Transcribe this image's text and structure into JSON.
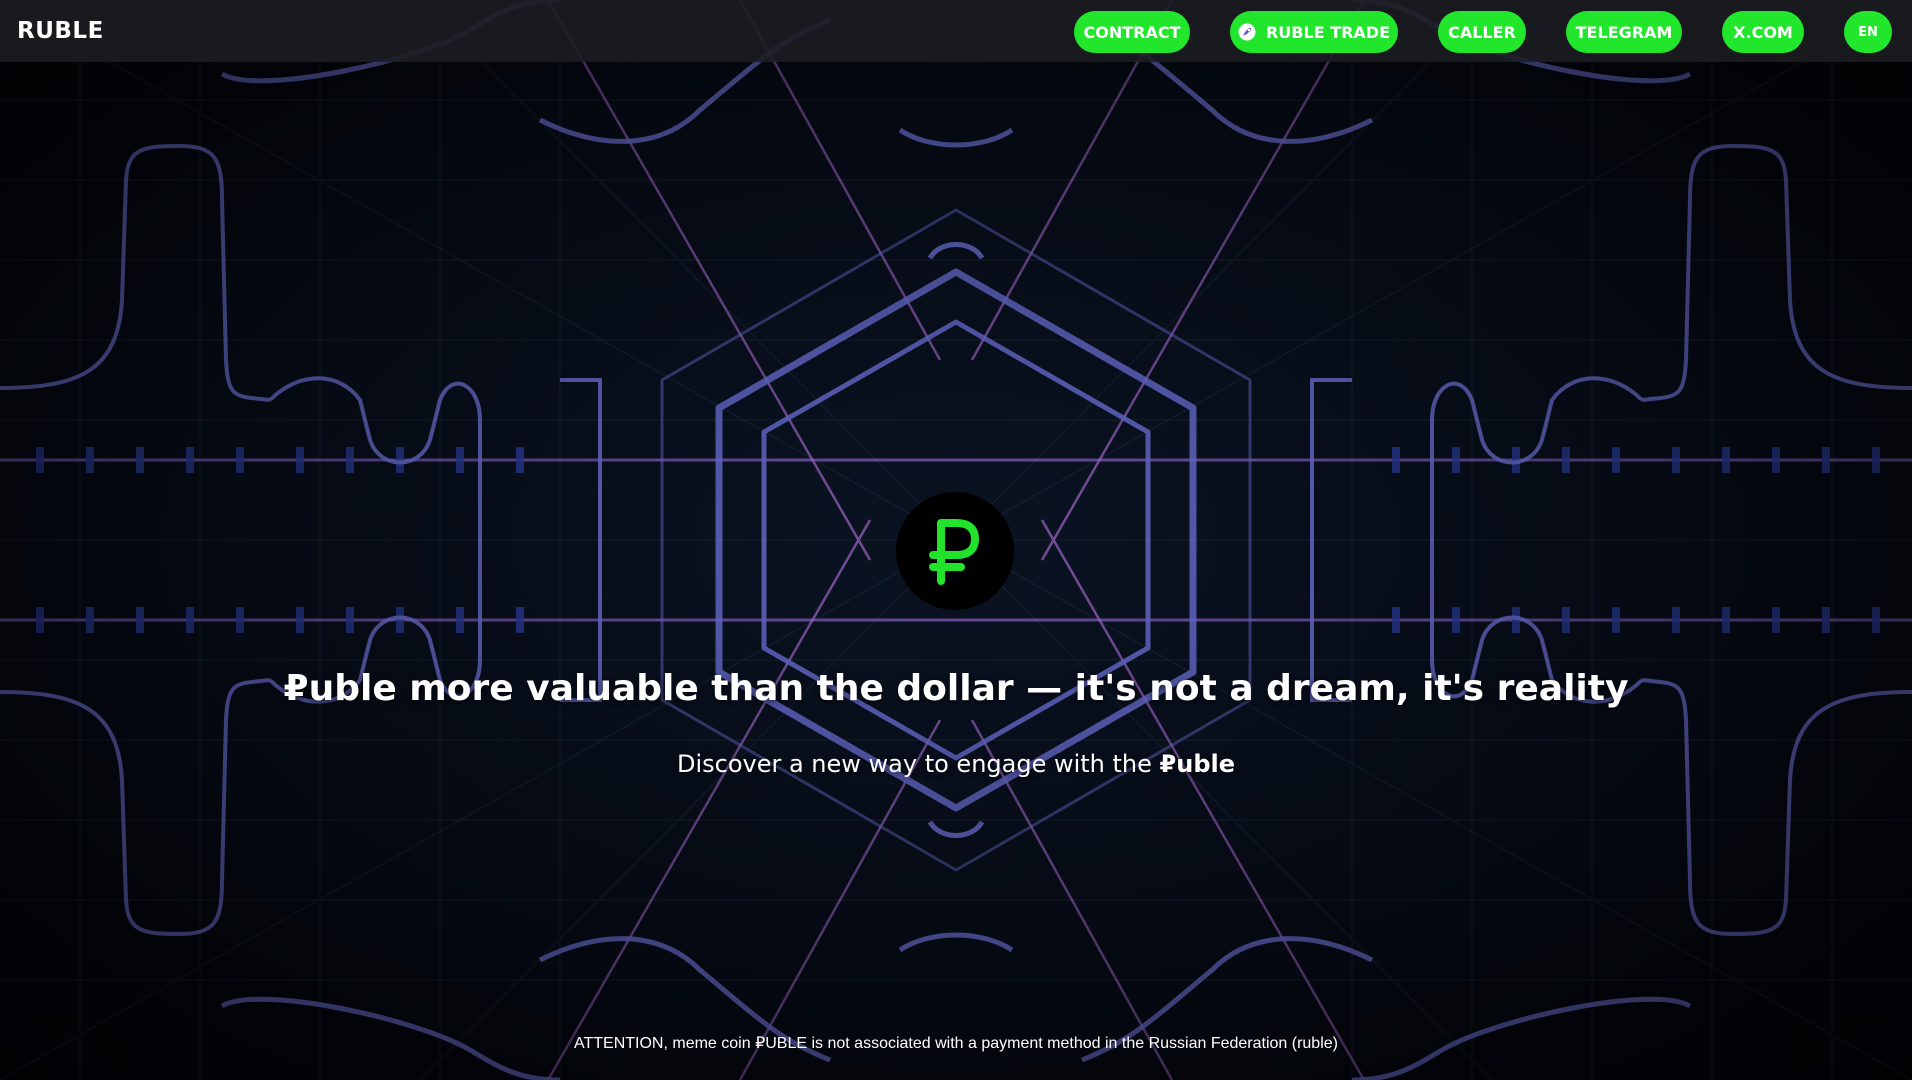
{
  "brand": {
    "name": "RUBLE"
  },
  "nav": {
    "contract": "CONTRACT",
    "ruble_trade": "RUBLE TRADE",
    "ruble_trade_icon": "rocket-icon",
    "caller": "CALLER",
    "telegram": "TELEGRAM",
    "xcom": "X.COM",
    "language": "EN"
  },
  "hero": {
    "logo_icon": "ruble-sign-icon",
    "headline_strong": "₽uble",
    "headline_rest": " more valuable than the dollar — it's not a dream, it's reality",
    "sub_prefix": "Discover a new way to engage with the ",
    "sub_strong": "₽uble"
  },
  "footer": {
    "attention": "ATTENTION, meme coin ₽UBLE is not associated with a payment method in the Russian Federation (ruble)"
  },
  "colors": {
    "accent": "#21e62c",
    "topbar": "#1c1e22",
    "background": "#05080f",
    "line_glow": "#6b6fd6"
  }
}
